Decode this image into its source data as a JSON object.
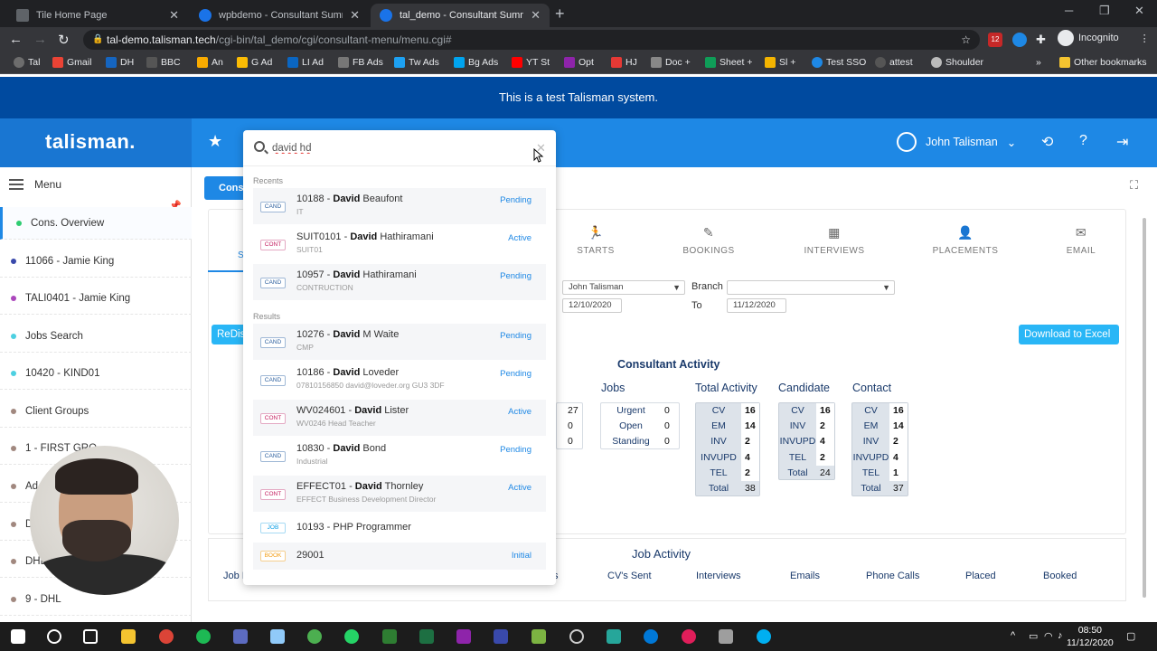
{
  "browser": {
    "tabs": [
      {
        "title": "Tile Home Page"
      },
      {
        "title": "wpbdemo - Consultant Summary"
      },
      {
        "title": "tal_demo - Consultant Summary"
      }
    ],
    "url_host": "tal-demo.talisman.tech",
    "url_path": "/cgi-bin/tal_demo/cgi/consultant-menu/menu.cgi#",
    "incognito_label": "Incognito",
    "extension_badge": "12",
    "bookmarks": [
      "Tal",
      "Gmail",
      "DH",
      "BBC",
      "An",
      "G Ad",
      "LI Ad",
      "FB Ads",
      "Tw Ads",
      "Bg Ads",
      "YT St",
      "Opt",
      "HJ",
      "Doc +",
      "Sheet +",
      "Sl +",
      "Test SSO",
      "attest",
      "Shoulder"
    ],
    "other_bookmarks": "Other bookmarks"
  },
  "banner": "This is a test Talisman system.",
  "app": {
    "logo": "talisman.",
    "user_name": "John Talisman"
  },
  "sidebar": {
    "menu_label": "Menu",
    "items": [
      {
        "label": "Cons. Overview",
        "color": "#2ecc71"
      },
      {
        "label": "11066 - Jamie King",
        "color": "#3949ab"
      },
      {
        "label": "TALI0401 - Jamie King",
        "color": "#ab47bc"
      },
      {
        "label": "Jobs Search",
        "color": "#4dd0e1"
      },
      {
        "label": "10420 - KIND01",
        "color": "#4dd0e1"
      },
      {
        "label": "Client Groups",
        "color": "#a1887f"
      },
      {
        "label": "1 - FIRST GRO...",
        "color": "#a1887f"
      },
      {
        "label": "Ad...",
        "color": "#a1887f"
      },
      {
        "label": "D...",
        "color": "#a1887f"
      },
      {
        "label": "DHL",
        "color": "#a1887f"
      },
      {
        "label": "9 - DHL",
        "color": "#a1887f"
      }
    ]
  },
  "main": {
    "cons_tab": "Cons.",
    "nav_tabs": [
      "STARTS",
      "BOOKINGS",
      "INTERVIEWS",
      "PLACEMENTS",
      "EMAIL"
    ],
    "s_letter": "S",
    "consultant_select": "John Talisman",
    "branch_label": "Branch",
    "from_date": "12/10/2020",
    "to_label": "To",
    "to_date": "11/12/2020",
    "redisplay": "ReDis",
    "download": "Download to Excel",
    "activity_title": "Consultant Activity",
    "left_values": [
      "27",
      "0",
      "0"
    ],
    "jobs": {
      "title": "Jobs",
      "rows": [
        {
          "k": "Urgent",
          "v": "0"
        },
        {
          "k": "Open",
          "v": "0"
        },
        {
          "k": "Standing",
          "v": "0"
        }
      ]
    },
    "total_activity": {
      "title": "Total Activity",
      "rows": [
        {
          "k": "CV",
          "v": "16"
        },
        {
          "k": "EM",
          "v": "14"
        },
        {
          "k": "INV",
          "v": "2"
        },
        {
          "k": "INVUPD",
          "v": "4"
        },
        {
          "k": "TEL",
          "v": "2"
        }
      ],
      "total_label": "Total",
      "total": "38"
    },
    "candidate": {
      "title": "Candidate",
      "rows": [
        {
          "k": "CV",
          "v": "16"
        },
        {
          "k": "INV",
          "v": "2"
        },
        {
          "k": "INVUPD",
          "v": "4"
        },
        {
          "k": "TEL",
          "v": "2"
        }
      ],
      "total_label": "Total",
      "total": "24"
    },
    "contact": {
      "title": "Contact",
      "rows": [
        {
          "k": "CV",
          "v": "16"
        },
        {
          "k": "EM",
          "v": "14"
        },
        {
          "k": "INV",
          "v": "2"
        },
        {
          "k": "INVUPD",
          "v": "4"
        },
        {
          "k": "TEL",
          "v": "1"
        }
      ],
      "total_label": "Total",
      "total": "37"
    },
    "job_activity_title": "Job Activity",
    "job_activity_cols": [
      "Job I",
      "s",
      "CV's Sent",
      "Interviews",
      "Emails",
      "Phone Calls",
      "Placed",
      "Booked"
    ]
  },
  "search": {
    "query": "david hd",
    "recents_label": "Recents",
    "results_label": "Results",
    "recents": [
      {
        "type": "CAND",
        "pre": "10188 - ",
        "match": "David",
        "post": " Beaufont",
        "sub": "IT",
        "status": "Pending"
      },
      {
        "type": "CONT",
        "pre": "SUIT0101 - ",
        "match": "David",
        "post": " Hathiramani",
        "sub": "SUIT01",
        "status": "Active"
      },
      {
        "type": "CAND",
        "pre": "10957 - ",
        "match": "David",
        "post": " Hathiramani",
        "sub": "CONTRUCTION",
        "status": "Pending"
      }
    ],
    "results": [
      {
        "type": "CAND",
        "pre": "10276 - ",
        "match": "David",
        "post": " M Waite",
        "sub": "CMP",
        "status": "Pending"
      },
      {
        "type": "CAND",
        "pre": "10186 - ",
        "match": "David",
        "post": " Loveder",
        "sub": "07810156850 david@loveder.org GU3 3DF",
        "status": "Pending"
      },
      {
        "type": "CONT",
        "pre": "WV024601 - ",
        "match": "David",
        "post": " Lister",
        "sub": "WV0246 Head Teacher",
        "status": "Active"
      },
      {
        "type": "CAND",
        "pre": "10830 - ",
        "match": "David",
        "post": " Bond",
        "sub": "Industrial",
        "status": "Pending"
      },
      {
        "type": "CONT",
        "pre": "EFFECT01 - ",
        "match": "David",
        "post": " Thornley",
        "sub": "EFFECT Business Development Director",
        "status": "Active"
      },
      {
        "type": "JOB",
        "pre": "10193 - PHP Programmer",
        "match": "",
        "post": "",
        "sub": "",
        "status": ""
      },
      {
        "type": "BOOK",
        "pre": "29001",
        "match": "",
        "post": "",
        "sub": "",
        "status": "Initial"
      }
    ]
  },
  "taskbar": {
    "time": "08:50",
    "date": "11/12/2020"
  }
}
